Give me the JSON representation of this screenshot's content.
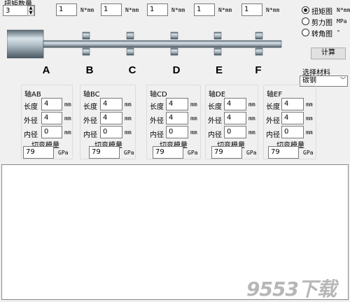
{
  "torque_count": {
    "label": "扭矩数量",
    "value": "3"
  },
  "torques": [
    {
      "value": "1",
      "unit": "N*mm"
    },
    {
      "value": "1",
      "unit": "N*mm"
    },
    {
      "value": "1",
      "unit": "N*mm"
    },
    {
      "value": "1",
      "unit": "N*mm"
    },
    {
      "value": "1",
      "unit": "N*mm"
    }
  ],
  "plot_options": [
    {
      "label": "扭矩图",
      "unit": "N*mm",
      "checked": true
    },
    {
      "label": "剪力图",
      "unit": "MPa",
      "checked": false
    },
    {
      "label": "转角图",
      "unit": "°",
      "checked": false
    }
  ],
  "compute_label": "计算",
  "material": {
    "label": "选择材料",
    "value": "碳钢"
  },
  "points": [
    "A",
    "B",
    "C",
    "D",
    "E",
    "F"
  ],
  "shafts": [
    {
      "title": "轴AB",
      "length": "4",
      "outer": "4",
      "inner": "0",
      "modulus": "79"
    },
    {
      "title": "轴BC",
      "length": "4",
      "outer": "4",
      "inner": "0",
      "modulus": "79"
    },
    {
      "title": "轴CD",
      "length": "4",
      "outer": "4",
      "inner": "0",
      "modulus": "79"
    },
    {
      "title": "轴DE",
      "length": "4",
      "outer": "4",
      "inner": "0",
      "modulus": "79"
    },
    {
      "title": "轴EF",
      "length": "4",
      "outer": "4",
      "inner": "0",
      "modulus": "79"
    }
  ],
  "labels": {
    "length": "长度",
    "outer": "外径",
    "inner": "内径",
    "modulus": "切变模量",
    "mm": "mm",
    "gpa": "GPa"
  },
  "watermark": "9553下载"
}
